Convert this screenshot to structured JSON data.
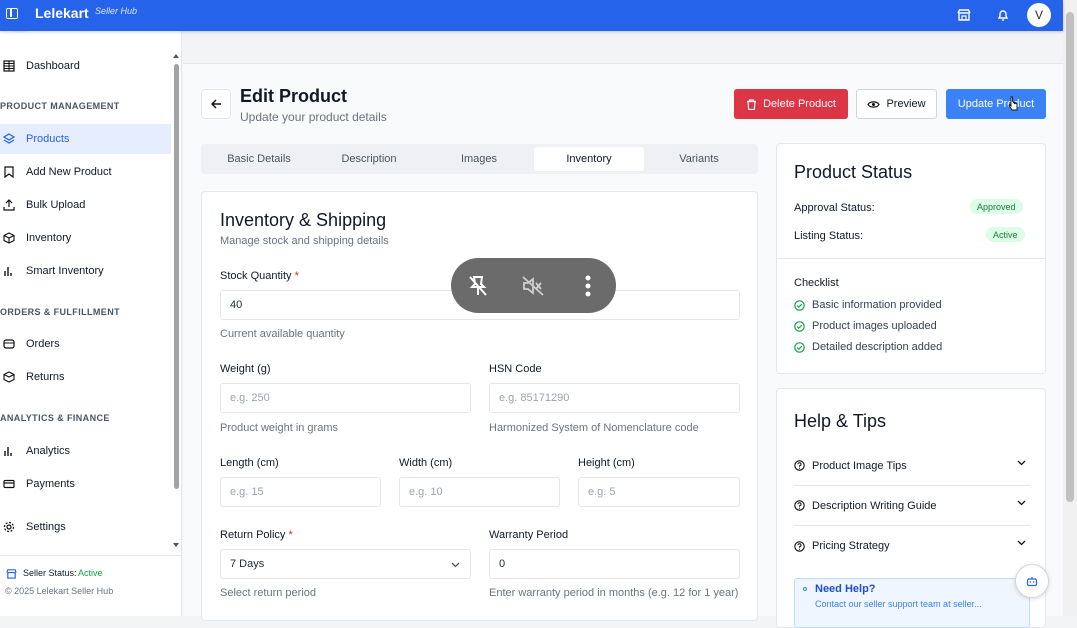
{
  "topbar": {
    "brand": "Lelekart",
    "brand_sub": "Seller Hub",
    "avatar": "V",
    "icons": [
      "sidebar-toggle-icon",
      "store-icon",
      "bell-icon"
    ]
  },
  "sidebar": {
    "items": [
      {
        "label": "Dashboard",
        "icon": "grid-icon"
      },
      {
        "label": "Products",
        "icon": "layers-icon"
      },
      {
        "label": "Add New Product",
        "icon": "bookmark-icon"
      },
      {
        "label": "Bulk Upload",
        "icon": "upload-icon"
      },
      {
        "label": "Inventory",
        "icon": "box-icon"
      },
      {
        "label": "Smart Inventory",
        "icon": "bar-chart-icon"
      },
      {
        "label": "Orders",
        "icon": "order-icon"
      },
      {
        "label": "Returns",
        "icon": "return-icon"
      },
      {
        "label": "Analytics",
        "icon": "bar-chart-icon"
      },
      {
        "label": "Payments",
        "icon": "card-icon"
      },
      {
        "label": "Settings",
        "icon": "gear-icon"
      }
    ],
    "sections": [
      "PRODUCT MANAGEMENT",
      "ORDERS & FULFILLMENT",
      "ANALYTICS & FINANCE"
    ],
    "seller_status_label": "Seller Status:",
    "seller_status_value": "Active",
    "copyright": "© 2025 Lelekart Seller Hub"
  },
  "page": {
    "title": "Edit Product",
    "subtitle": "Update your product details",
    "delete_label": "Delete Product",
    "preview_label": "Preview",
    "update_label": "Update Product"
  },
  "tabs": [
    "Basic Details",
    "Description",
    "Images",
    "Inventory",
    "Variants"
  ],
  "form": {
    "title": "Inventory & Shipping",
    "subtitle": "Manage stock and shipping details",
    "stock_label": "Stock Quantity",
    "stock_value": "40",
    "stock_help": "Current available quantity",
    "weight_label": "Weight (g)",
    "weight_placeholder": "e.g. 250",
    "weight_help": "Product weight in grams",
    "hsn_label": "HSN Code",
    "hsn_placeholder": "e.g. 85171290",
    "hsn_help": "Harmonized System of Nomenclature code",
    "length_label": "Length (cm)",
    "length_placeholder": "e.g. 15",
    "width_label": "Width (cm)",
    "width_placeholder": "e.g. 10",
    "height_label": "Height (cm)",
    "height_placeholder": "e.g. 5",
    "return_label": "Return Policy",
    "return_value": "7 Days",
    "return_help": "Select return period",
    "warranty_label": "Warranty Period",
    "warranty_value": "0",
    "warranty_help": "Enter warranty period in months (e.g. 12 for 1 year)",
    "required_mark": "*"
  },
  "status": {
    "title": "Product Status",
    "approval_label": "Approval Status:",
    "approval_value": "Approved",
    "listing_label": "Listing Status:",
    "listing_value": "Active",
    "checklist_title": "Checklist",
    "checklist": [
      "Basic information provided",
      "Product images uploaded",
      "Detailed description added"
    ]
  },
  "help": {
    "title": "Help & Tips",
    "items": [
      "Product Image Tips",
      "Description Writing Guide",
      "Pricing Strategy"
    ],
    "need_help": "Need Help?",
    "need_help_text": "Contact our seller support team at seller..."
  },
  "colors": {
    "accent": "#2563eb",
    "danger": "#dc3545",
    "success": "#16a34a"
  }
}
